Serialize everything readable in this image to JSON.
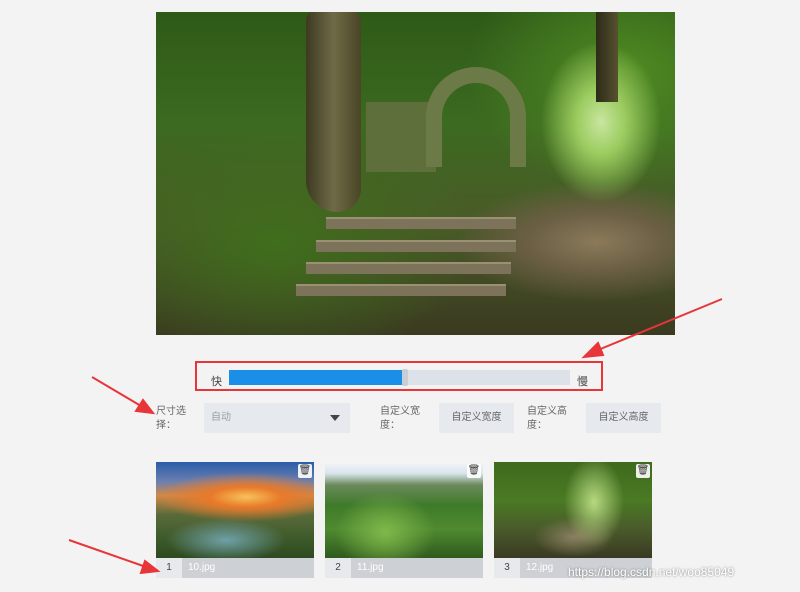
{
  "speed": {
    "fast_label": "快",
    "slow_label": "慢",
    "value_percent": 51
  },
  "size_select": {
    "label": "尺寸选择：",
    "value": "自动"
  },
  "custom_width": {
    "label": "自定义宽度：",
    "placeholder": "自定义宽度"
  },
  "custom_height": {
    "label": "自定义高度：",
    "placeholder": "自定义高度"
  },
  "thumbnails": [
    {
      "index": "1",
      "name": "10.jpg"
    },
    {
      "index": "2",
      "name": "11.jpg"
    },
    {
      "index": "3",
      "name": "12.jpg"
    }
  ],
  "watermark": "https://blog.csdn.net/woo85049",
  "colors": {
    "accent": "#1b8fe8",
    "highlight": "#e8353a"
  },
  "icons": {
    "delete": "trash-icon",
    "dropdown": "chevron-down-icon"
  }
}
